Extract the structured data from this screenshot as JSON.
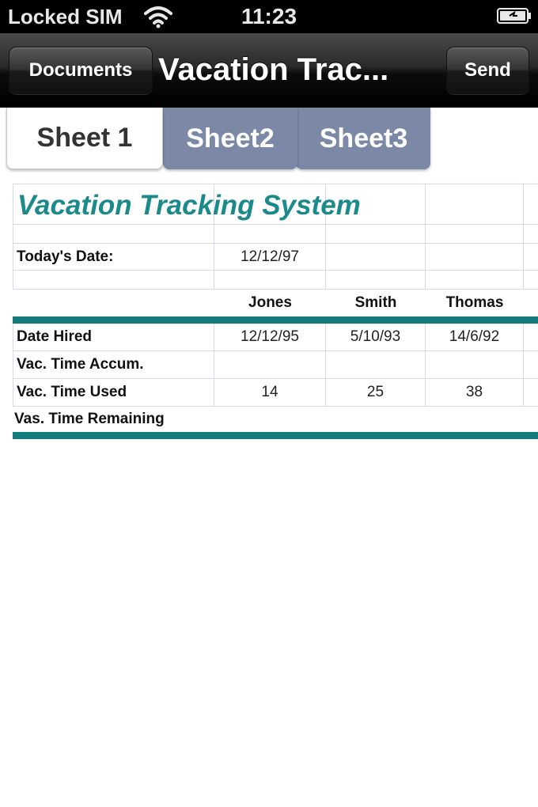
{
  "status_bar": {
    "carrier": "Locked SIM",
    "time": "11:23"
  },
  "nav_bar": {
    "left_button": "Documents",
    "title": "Vacation Trac...",
    "right_button": "Send"
  },
  "tabs": [
    {
      "label": "Sheet 1",
      "active": true
    },
    {
      "label": "Sheet2",
      "active": false
    },
    {
      "label": "Sheet3",
      "active": false
    }
  ],
  "sheet": {
    "title": "Vacation Tracking System",
    "todays_date_label": "Today's Date:",
    "todays_date_value": "12/12/97",
    "columns": [
      "Jones",
      "Smith",
      "Thomas"
    ],
    "rows": [
      {
        "label": "Date Hired",
        "values": [
          "12/12/95",
          "5/10/93",
          "14/6/92"
        ]
      },
      {
        "label": "Vac. Time Accum.",
        "values": [
          "",
          "",
          ""
        ]
      },
      {
        "label": "Vac. Time Used",
        "values": [
          "14",
          "25",
          "38"
        ]
      },
      {
        "label": "Vas. Time Remaining",
        "values": [
          "",
          "",
          ""
        ]
      }
    ],
    "title_color": "#1a8a8a",
    "rule_color": "#127c7c"
  },
  "colors": {
    "tab_inactive": "#7b88a6"
  },
  "icons": [
    "wifi-icon",
    "battery-icon"
  ]
}
